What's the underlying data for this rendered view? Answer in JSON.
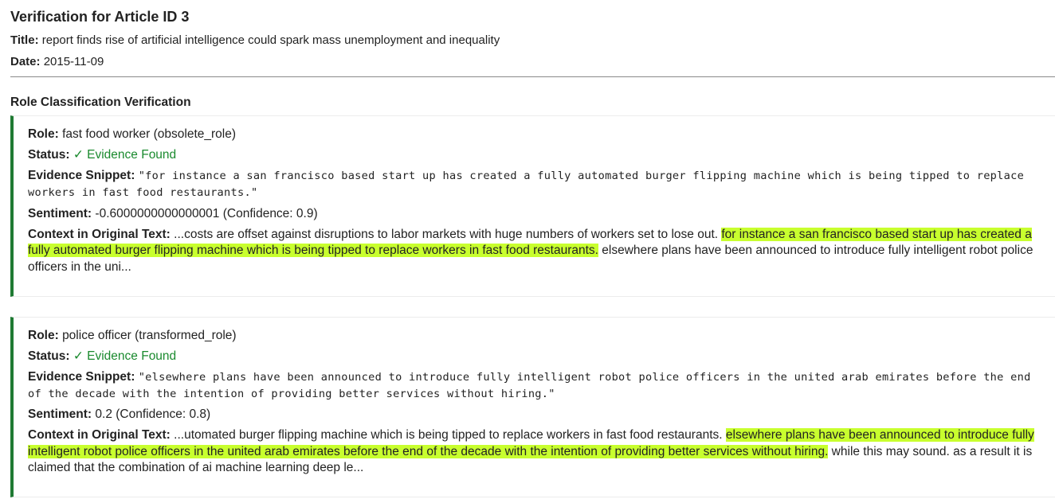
{
  "header": {
    "title": "Verification for Article ID 3",
    "title_label": "Title:",
    "title_value": "report finds rise of artificial intelligence could spark mass unemployment and inequality",
    "date_label": "Date:",
    "date_value": "2015-11-09"
  },
  "section": {
    "heading": "Role Classification Verification"
  },
  "labels": {
    "role": "Role:",
    "status": "Status:",
    "snippet": "Evidence Snippet:",
    "sentiment": "Sentiment:",
    "context": "Context in Original Text:"
  },
  "colors": {
    "accent_border": "#1f7a33",
    "status_ok": "#1a8a2e",
    "highlight": "#c8ff2e"
  },
  "cards": [
    {
      "role": "fast food worker (obsolete_role)",
      "status_icon": "check-icon",
      "status": "✓ Evidence Found",
      "snippet": "\"for instance a san francisco based start up has created a fully automated burger flipping machine which is being tipped to replace workers in fast food restaurants.\"",
      "sentiment": "-0.6000000000000001 (Confidence: 0.9)",
      "context_before": "...costs are offset against disruptions to labor markets with huge numbers of workers set to lose out. ",
      "context_highlight": "for instance a san francisco based start up has created a fully automated burger flipping machine which is being tipped to replace workers in fast food restaurants.",
      "context_after": " elsewhere plans have been announced to introduce fully intelligent robot police officers in the uni..."
    },
    {
      "role": "police officer (transformed_role)",
      "status_icon": "check-icon",
      "status": "✓ Evidence Found",
      "snippet": "\"elsewhere plans have been announced to introduce fully intelligent robot police officers in the united arab emirates before the end of the decade with the intention of providing better services without hiring.\"",
      "sentiment": "0.2 (Confidence: 0.8)",
      "context_before": "...utomated burger flipping machine which is being tipped to replace workers in fast food restaurants. ",
      "context_highlight": "elsewhere plans have been announced to introduce fully intelligent robot police officers in the united arab emirates before the end of the decade with the intention of providing better services without hiring.",
      "context_after": " while this may sound. as a result it is claimed that the combination of ai machine learning deep le..."
    }
  ]
}
